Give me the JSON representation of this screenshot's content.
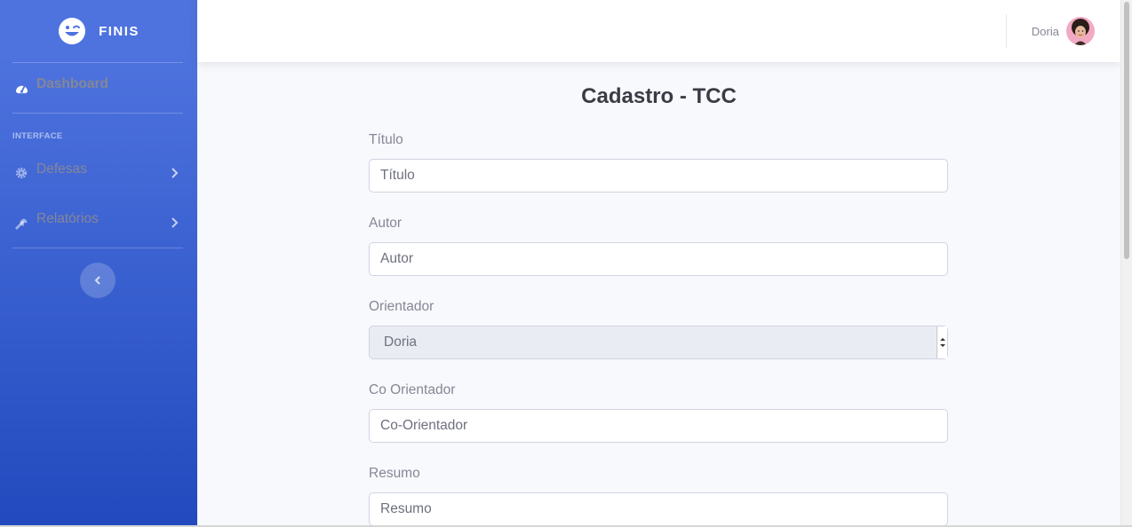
{
  "brand": {
    "name": "FINIS",
    "icon": "laugh-wink-icon"
  },
  "sidebar": {
    "dashboard": {
      "label": "Dashboard",
      "icon": "tachometer-icon"
    },
    "heading": "INTERFACE",
    "items": [
      {
        "label": "Defesas",
        "icon": "cog-icon"
      },
      {
        "label": "Relatórios",
        "icon": "wrench-icon"
      }
    ],
    "toggle_icon": "chevron-left-icon"
  },
  "topbar": {
    "user_name": "Doria"
  },
  "page": {
    "title": "Cadastro - TCC"
  },
  "form": {
    "titulo": {
      "label": "Título",
      "placeholder": "Título"
    },
    "autor": {
      "label": "Autor",
      "placeholder": "Autor"
    },
    "orientador": {
      "label": "Orientador",
      "value": "Doria"
    },
    "coorientador": {
      "label": "Co Orientador",
      "placeholder": "Co-Orientador"
    },
    "resumo": {
      "label": "Resumo",
      "placeholder": "Resumo"
    }
  },
  "colors": {
    "primary": "#4e73df",
    "primary_dark": "#224abe",
    "text_muted": "#858796",
    "bg": "#f8f9fc"
  }
}
